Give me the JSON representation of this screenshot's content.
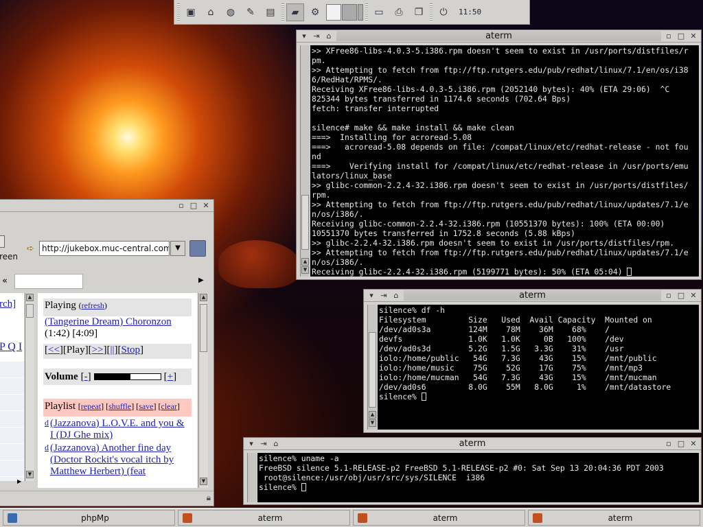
{
  "panel": {
    "clock": "11:50"
  },
  "term1": {
    "title": "aterm",
    "lines": [
      ">> XFree86-libs-4.0.3-5.i386.rpm doesn't seem to exist in /usr/ports/distfiles/r",
      "pm.",
      ">> Attempting to fetch from ftp://ftp.rutgers.edu/pub/redhat/linux/7.1/en/os/i38",
      "6/RedHat/RPMS/.",
      "Receiving XFree86-libs-4.0.3-5.i386.rpm (2052140 bytes): 40% (ETA 29:06)  ^C",
      "825344 bytes transferred in 1174.6 seconds (702.64 Bps)",
      "fetch: transfer interrupted",
      "",
      "silence# make && make install && make clean",
      "===>  Installing for acroread-5.08",
      "===>   acroread-5.08 depends on file: /compat/linux/etc/redhat-release - not fou",
      "nd",
      "===>    Verifying install for /compat/linux/etc/redhat-release in /usr/ports/emu",
      "lators/linux_base",
      ">> glibc-common-2.2.4-32.i386.rpm doesn't seem to exist in /usr/ports/distfiles/",
      "rpm.",
      ">> Attempting to fetch from ftp://ftp.rutgers.edu/pub/redhat/linux/updates/7.1/e",
      "n/os/i386/.",
      "Receiving glibc-common-2.2.4-32.i386.rpm (10551370 bytes): 100% (ETA 00:00)",
      "10551370 bytes transferred in 1752.8 seconds (5.88 kBps)",
      ">> glibc-2.2.4-32.i386.rpm doesn't seem to exist in /usr/ports/distfiles/rpm.",
      ">> Attempting to fetch from ftp://ftp.rutgers.edu/pub/redhat/linux/updates/7.1/e",
      "n/os/i386/.",
      "Receiving glibc-2.2.4-32.i386.rpm (5199771 bytes): 50% (ETA 05:04) "
    ]
  },
  "term2": {
    "title": "aterm",
    "lines": [
      "silence% df -h",
      "Filesystem         Size   Used  Avail Capacity  Mounted on",
      "/dev/ad0s3a        124M    78M    36M    68%    /",
      "devfs              1.0K   1.0K     0B   100%    /dev",
      "/dev/ad0s3d        5.2G   1.5G   3.3G    31%    /usr",
      "iolo:/home/public   54G   7.3G    43G    15%    /mnt/public",
      "iolo:/home/music    75G    52G    17G    75%    /mnt/mp3",
      "iolo:/home/mucman   54G   7.3G    43G    15%    /mnt/mucman",
      "/dev/ad0s6         8.0G    55M   8.0G     1%    /mnt/datastore",
      "silence% "
    ]
  },
  "term3": {
    "title": "aterm",
    "lines": [
      "silence% uname -a",
      "FreeBSD silence 5.1-RELEASE-p2 FreeBSD 5.1-RELEASE-p2 #0: Sat Sep 13 20:04:36 PDT 2003",
      " root@silence:/usr/obj/usr/src/sys/SILENCE  i386",
      "silence% "
    ]
  },
  "browser": {
    "url": "http://jukebox.muc-central.com/j",
    "partial_label": "reen",
    "back_symbol": "«",
    "sidebar": {
      "search_fragment": "rch]",
      "letters": "P Q I"
    },
    "playing": {
      "label": "Playing",
      "refresh": "refresh",
      "track": "(Tangerine Dream) Choronzon",
      "time": "(1:42) [4:09]",
      "prev": "<<",
      "play": "Play",
      "next": ">>",
      "pause": "||",
      "stop": "Stop"
    },
    "volume": {
      "label": "Volume",
      "minus": "-",
      "plus": "+",
      "level": 0.55
    },
    "playlist": {
      "label": "Playlist",
      "repeat": "repeat",
      "shuffle": "shuffle",
      "save": "save",
      "clear": "clear",
      "items": [
        {
          "del": "d",
          "text": "(Jazzanova) L.O.V.E. and you & I (DJ Ghe mix)"
        },
        {
          "del": "d",
          "text": "(Jazzanova) Another fine day (Doctor Rockit's vocal itch by Matthew Herbert) (feat"
        }
      ]
    }
  },
  "taskbar": {
    "items": [
      "phpMp",
      "aterm",
      "aterm",
      "aterm"
    ]
  }
}
